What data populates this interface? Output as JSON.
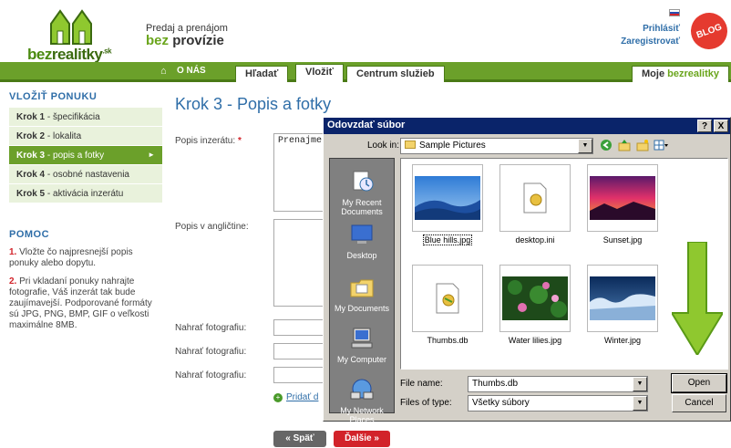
{
  "header": {
    "logo_text_1": "bez",
    "logo_text_2": "realitky",
    "logo_sup": ".sk",
    "tagline_line1": "Predaj a prenájom",
    "tagline_bez": "bez",
    "tagline_provizie": "provízie",
    "login": "Prihlásiť",
    "register": "Zaregistrovať",
    "blog": "BLOG"
  },
  "nav": {
    "home_icon": "home-icon",
    "onas": "O NÁS",
    "hladat": "Hľadať",
    "vlozit": "Vložiť",
    "centrum": "Centrum služieb",
    "moje_1": "Moje",
    "moje_2": "bezrealitky"
  },
  "sidebar": {
    "title": "VLOŽIŤ PONUKU",
    "steps": [
      {
        "num": "Krok 1",
        "label": "špecifikácia"
      },
      {
        "num": "Krok 2",
        "label": "lokalita"
      },
      {
        "num": "Krok 3",
        "label": "popis a fotky"
      },
      {
        "num": "Krok 4",
        "label": "osobné nastavenia"
      },
      {
        "num": "Krok 5",
        "label": "aktivácia inzerátu"
      }
    ],
    "help_title": "POMOC",
    "help_1_num": "1.",
    "help_1": "Vložte čo najpresnejší popis ponuky alebo dopytu.",
    "help_2_num": "2.",
    "help_2": "Pri vkladaní ponuky nahrajte fotografie, Váš inzerát tak bude zaujímavejší. Podporované formáty sú JPG, PNG, BMP, GIF o veľkosti maximálne 8MB."
  },
  "main": {
    "title": "Krok 3 - Popis a fotky",
    "popis_label": "Popis inzerátu:",
    "required_mark": "*",
    "popis_value": "Prenajme",
    "popis_en_label": "Popis v angličtine:",
    "upload_label": "Nahrať fotografiu:",
    "add_link": "Pridať d",
    "back_btn": "« Späť",
    "next_btn": "Ďalšie »"
  },
  "dialog": {
    "title": "Odovzdať súbor",
    "help_btn": "?",
    "close_btn": "X",
    "look_in_label": "Look in:",
    "look_in_value": "Sample Pictures",
    "places": [
      "My Recent Documents",
      "Desktop",
      "My Documents",
      "My Computer",
      "My Network Places"
    ],
    "files": [
      "Blue hills.jpg",
      "desktop.ini",
      "Sunset.jpg",
      "Thumbs.db",
      "Water lilies.jpg",
      "Winter.jpg"
    ],
    "file_name_label": "File name:",
    "file_name_value": "Thumbs.db",
    "file_type_label": "Files of type:",
    "file_type_value": "Všetky súbory",
    "open_btn": "Open",
    "cancel_btn": "Cancel"
  },
  "colors": {
    "brand_green": "#6ba02a",
    "link_blue": "#2f6ea8",
    "accent_red": "#d2232a",
    "dialog_title": "#0a246a",
    "arrow_green": "#8fc82f"
  }
}
